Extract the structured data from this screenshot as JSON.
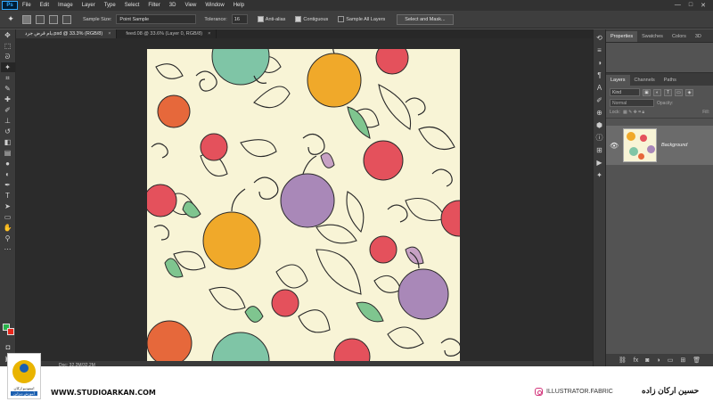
{
  "menu": {
    "logo": "Ps",
    "items": [
      "File",
      "Edit",
      "Image",
      "Layer",
      "Type",
      "Select",
      "Filter",
      "3D",
      "View",
      "Window",
      "Help"
    ],
    "window_controls": [
      "—",
      "□",
      "✕"
    ]
  },
  "options": {
    "sample_size_label": "Sample Size:",
    "sample_size_value": "Point Sample",
    "tolerance_label": "Tolerance:",
    "tolerance_value": "16",
    "anti_alias_label": "Anti-alias",
    "contiguous_label": "Contiguous",
    "sample_all_layers_label": "Sample All Layers",
    "select_mask_label": "Select and Mask..."
  },
  "document_tabs": [
    {
      "label": "یام قرض جرد.psd @ 33.3% (RGB/8)",
      "close": "×"
    },
    {
      "label": "feed.08 @ 33.6% (Layer 0, RGB/8)",
      "close": "×"
    }
  ],
  "status": {
    "doc_size": "Doc: 32.2M/32.2M"
  },
  "panels": {
    "top_tabs": [
      "Properties",
      "Swatches",
      "Colors",
      "3D"
    ],
    "layer_tabs": [
      "Layers",
      "Channels",
      "Paths"
    ],
    "kind_label": "Kind",
    "blend_mode": "Normal",
    "opacity_label": "Opacity:",
    "lock_label": "Lock:",
    "fill_label": "Fill:",
    "layer_name": "Background"
  },
  "branding": {
    "logo_line1": "استودیو ارکان",
    "logo_line2": "آموزش دیزاین",
    "website": "WWW.STUDIOARKAN.COM",
    "instagram": "ILLUSTRATOR.FABRIC",
    "author": "حسین  ارکان زاده"
  },
  "colors": {
    "foreground": "#28b24a",
    "background": "#e8271c",
    "artboard": "#f8f4d6"
  },
  "icons": {
    "tools": [
      "move-tool-icon",
      "marquee-tool-icon",
      "lasso-tool-icon",
      "magic-wand-tool-icon",
      "crop-tool-icon",
      "eyedropper-tool-icon",
      "healing-brush-tool-icon",
      "brush-tool-icon",
      "clone-stamp-tool-icon",
      "history-brush-tool-icon",
      "eraser-tool-icon",
      "gradient-tool-icon",
      "blur-tool-icon",
      "dodge-tool-icon",
      "pen-tool-icon",
      "type-tool-icon",
      "path-selection-tool-icon",
      "shape-tool-icon",
      "hand-tool-icon",
      "zoom-tool-icon"
    ]
  }
}
